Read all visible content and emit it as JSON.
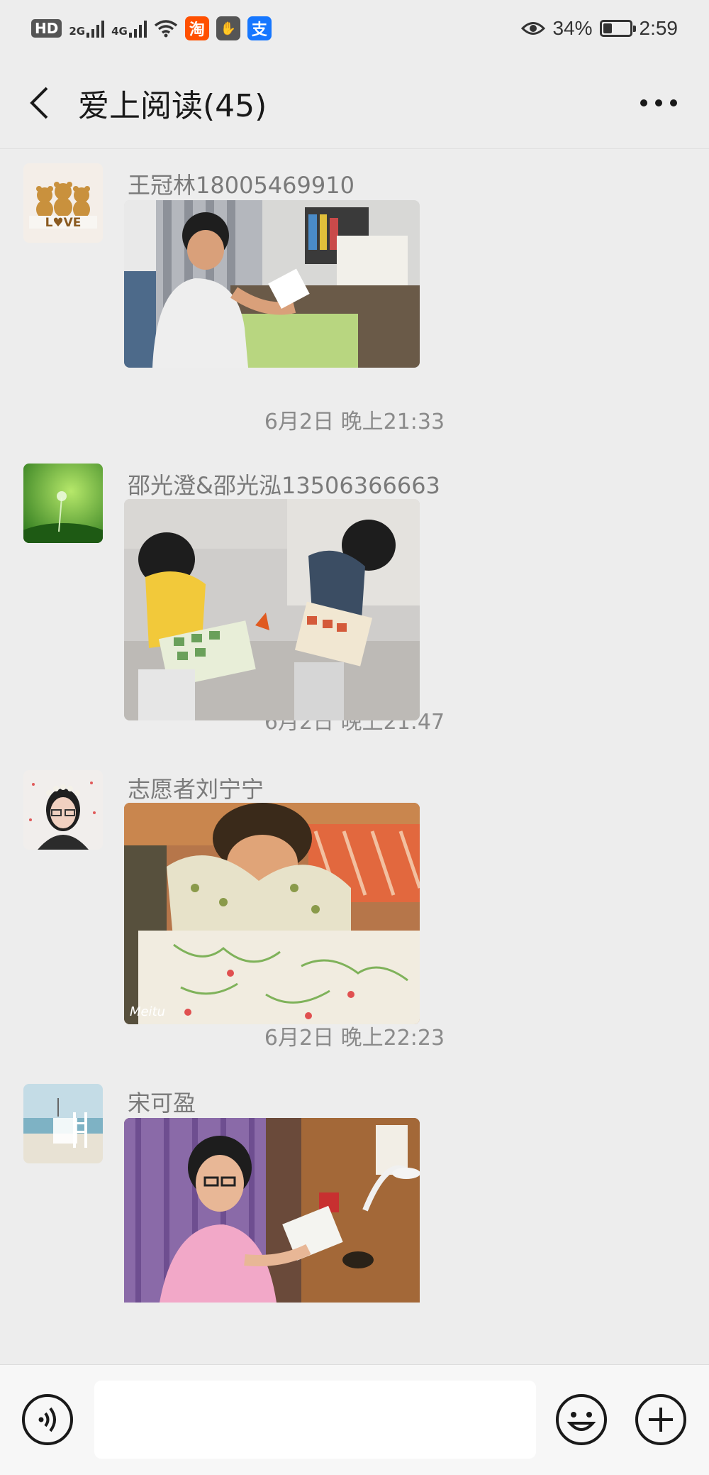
{
  "status_bar": {
    "hd_badge": "HD",
    "sim2": "2",
    "net1": "2G",
    "net2": "4G",
    "apps": [
      {
        "icon": "taobao-icon",
        "label": "淘",
        "color": "#ff5000"
      },
      {
        "icon": "hand-icon",
        "label": "✋",
        "color": "#555555"
      },
      {
        "icon": "alipay-icon",
        "label": "支",
        "color": "#1677ff"
      }
    ],
    "battery_percent_text": "34%",
    "battery_level": 0.34,
    "time": "2:59"
  },
  "header": {
    "back_icon": "back-chevron-icon",
    "title": "爱上阅读(45)",
    "more_icon": "more-dots-icon"
  },
  "messages": [
    {
      "sender": "王冠林18005469910",
      "avatar": "teddy-bears-love-avatar",
      "photo": "boy-reading-at-desk-photo"
    },
    {
      "timestamp": "6月2日 晚上21:33"
    },
    {
      "sender": "邵光澄&邵光泓13506366663",
      "avatar": "dandelion-green-avatar",
      "photo": "two-kids-reading-on-sofa-photo"
    },
    {
      "timestamp": "6月2日 晚上21:47"
    },
    {
      "sender": "志愿者刘宁宁",
      "avatar": "woman-glasses-flower-crown-avatar",
      "photo": "child-reading-big-picture-book-photo",
      "watermark": "Meitu"
    },
    {
      "timestamp": "6月2日 晚上22:23"
    },
    {
      "sender": "宋可盈",
      "avatar": "seaside-chair-avatar",
      "photo": "girl-reading-with-lamp-photo"
    }
  ],
  "input_bar": {
    "voice_icon": "voice-icon",
    "input_value": "",
    "emoji_icon": "emoji-icon",
    "plus_icon": "plus-icon"
  },
  "colors": {
    "background": "#ededed",
    "input_bar": "#f7f7f7"
  }
}
